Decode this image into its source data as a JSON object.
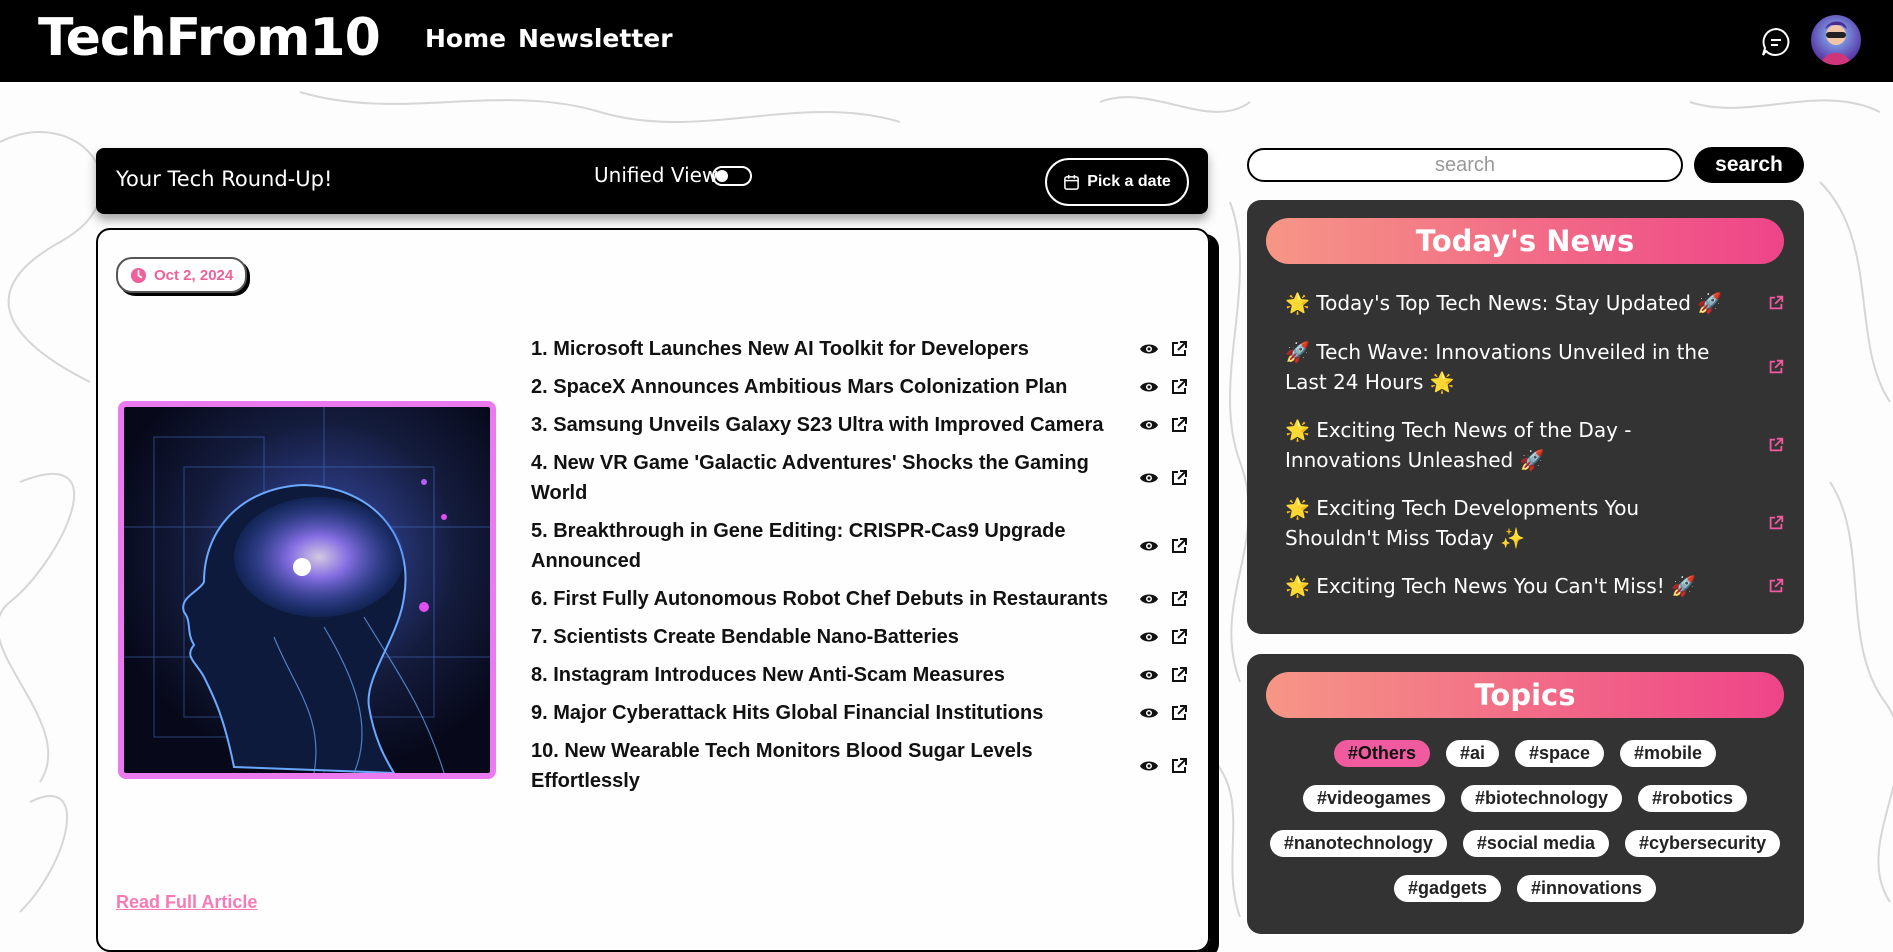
{
  "nav": {
    "brand": "TechFrom10",
    "links": [
      "Home",
      "Newsletter"
    ]
  },
  "toolbar": {
    "title": "Your Tech Round-Up!",
    "toggle_label": "Unified View",
    "toggle_on": false,
    "date_button": "Pick a date"
  },
  "article": {
    "date": "Oct 2, 2024",
    "items": [
      "1. Microsoft Launches New AI Toolkit for Developers",
      "2. SpaceX Announces Ambitious Mars Colonization Plan",
      "3. Samsung Unveils Galaxy S23 Ultra with Improved Camera",
      "4. New VR Game 'Galactic Adventures' Shocks the Gaming World",
      "5. Breakthrough in Gene Editing: CRISPR-Cas9 Upgrade Announced",
      "6. First Fully Autonomous Robot Chef Debuts in Restaurants",
      "7. Scientists Create Bendable Nano-Batteries",
      "8. Instagram Introduces New Anti-Scam Measures",
      "9. Major Cyberattack Hits Global Financial Institutions",
      "10. New Wearable Tech Monitors Blood Sugar Levels Effortlessly"
    ],
    "read_more": "Read Full Article"
  },
  "search": {
    "placeholder": "search",
    "button": "search"
  },
  "todays_news": {
    "title": "Today's News",
    "items": [
      "🌟 Today's Top Tech News: Stay Updated 🚀",
      "🚀 Tech Wave: Innovations Unveiled in the Last 24 Hours 🌟",
      "🌟 Exciting Tech News of the Day - Innovations Unleashed 🚀",
      "🌟 Exciting Tech Developments You Shouldn't Miss Today ✨",
      "🌟 Exciting Tech News You Can't Miss! 🚀"
    ]
  },
  "topics": {
    "title": "Topics",
    "tags": [
      "#Others",
      "#ai",
      "#space",
      "#mobile",
      "#videogames",
      "#biotechnology",
      "#robotics",
      "#nanotechnology",
      "#social media",
      "#cybersecurity",
      "#gadgets",
      "#innovations"
    ],
    "active": "#Others"
  },
  "colors": {
    "accent_pink": "#f05a9e",
    "gradient_start": "#f69686",
    "gradient_end": "#ee4488",
    "image_border": "#ea7aee"
  }
}
